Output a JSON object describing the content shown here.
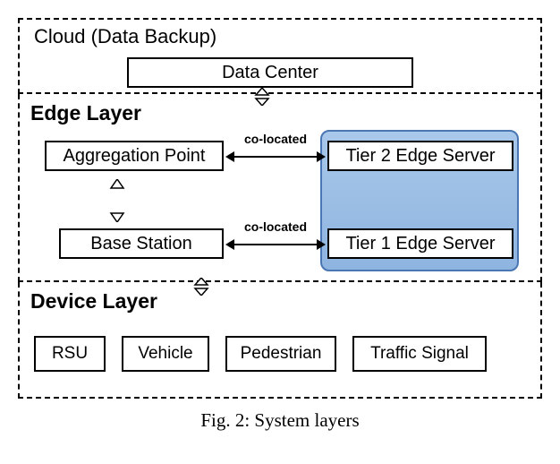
{
  "layers": {
    "cloud": {
      "title": "Cloud (Data Backup)",
      "data_center": "Data Center"
    },
    "edge": {
      "title": "Edge Layer",
      "aggregation_point": "Aggregation Point",
      "base_station": "Base Station",
      "tier2": "Tier 2 Edge Server",
      "tier1": "Tier 1 Edge Server",
      "colocated_label": "co-located"
    },
    "device": {
      "title": "Device Layer",
      "items": {
        "rsu": "RSU",
        "vehicle": "Vehicle",
        "pedestrian": "Pedestrian",
        "traffic_signal": "Traffic Signal"
      }
    }
  },
  "caption": "Fig. 2: System layers",
  "chart_data": {
    "type": "diagram",
    "title": "System layers",
    "layers": [
      {
        "name": "Cloud (Data Backup)",
        "nodes": [
          "Data Center"
        ]
      },
      {
        "name": "Edge Layer",
        "nodes": [
          "Aggregation Point",
          "Base Station",
          "Tier 2 Edge Server",
          "Tier 1 Edge Server"
        ],
        "grouped": {
          "label": "edge-server-group",
          "members": [
            "Tier 2 Edge Server",
            "Tier 1 Edge Server"
          ]
        }
      },
      {
        "name": "Device Layer",
        "nodes": [
          "RSU",
          "Vehicle",
          "Pedestrian",
          "Traffic Signal"
        ]
      }
    ],
    "edges": [
      {
        "from": "Data Center",
        "to": "Aggregation Point",
        "type": "bidirectional-hollow",
        "label": ""
      },
      {
        "from": "Aggregation Point",
        "to": "Tier 2 Edge Server",
        "type": "bidirectional",
        "label": "co-located"
      },
      {
        "from": "Aggregation Point",
        "to": "Base Station",
        "type": "bidirectional-hollow",
        "label": ""
      },
      {
        "from": "Base Station",
        "to": "Tier 1 Edge Server",
        "type": "bidirectional",
        "label": "co-located"
      },
      {
        "from": "Base Station",
        "to": "Device Layer",
        "type": "bidirectional-hollow",
        "label": ""
      }
    ]
  }
}
